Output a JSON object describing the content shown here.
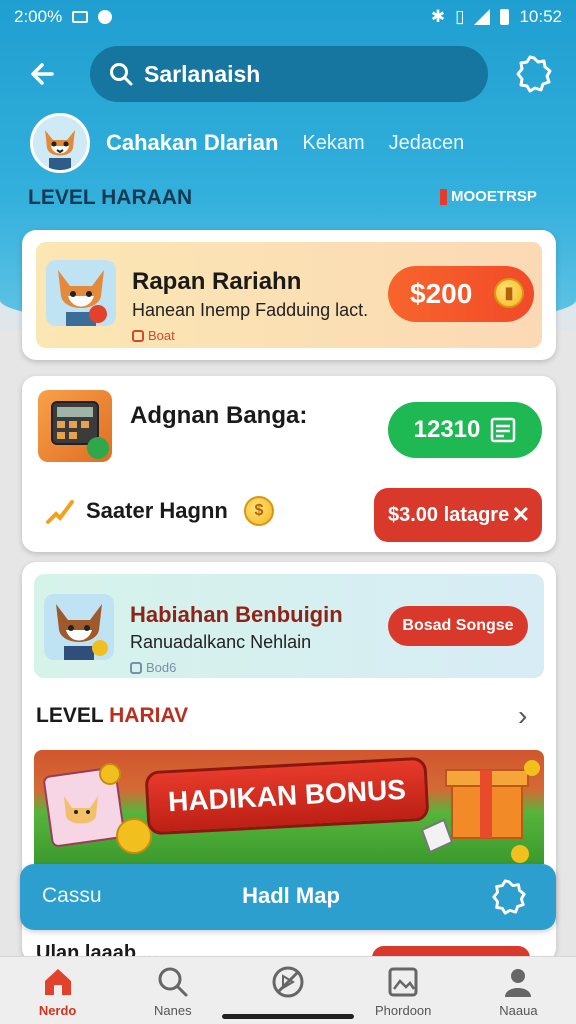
{
  "status_bar": {
    "time_left": "2:00%",
    "time_right": "10:52"
  },
  "header": {
    "search_value": "Sarlanaish",
    "profile_name": "Cahakan Dlarian",
    "tabs": [
      "Kekam",
      "Jedacen"
    ],
    "level_title": "LEVEL HARAAN",
    "level_link": "MOOETRSP"
  },
  "card1": {
    "title": "Rapan Rariahn",
    "subtitle": "Hanean Inemp Fadduing lact.",
    "meta": "Boat",
    "price": "$200"
  },
  "card2": {
    "title": "Adgnan Banga:",
    "score": "12310",
    "offer_label": "Saater Hagnn",
    "offer_button": "$3.00 latagre"
  },
  "card3": {
    "title": "Habiahan Benbuigin",
    "subtitle": "Ranuadalkanc Nehlain",
    "meta": "Bod6",
    "button": "Bosad Songse"
  },
  "section2": {
    "title_part1": "LEVEL ",
    "title_part2": "HARIAV"
  },
  "banner": {
    "label": "HADIKAN BONUS"
  },
  "bottom_bar": {
    "left": "Cassu",
    "center": "Hadl Map"
  },
  "peek_text": "Ulan laaab ...",
  "nav": {
    "items": [
      {
        "label": "Nerdo",
        "icon": "home-icon",
        "active": true
      },
      {
        "label": "Nanes",
        "icon": "search-icon",
        "active": false
      },
      {
        "label": "",
        "icon": "no-ads-icon",
        "active": false
      },
      {
        "label": "Phordoon",
        "icon": "picture-icon",
        "active": false
      },
      {
        "label": "Naaua",
        "icon": "profile-icon",
        "active": false
      }
    ]
  },
  "colors": {
    "header_blue": "#1f9fd0",
    "accent_orange": "#f7652b",
    "accent_green": "#1fb954",
    "accent_red": "#d9392b"
  }
}
